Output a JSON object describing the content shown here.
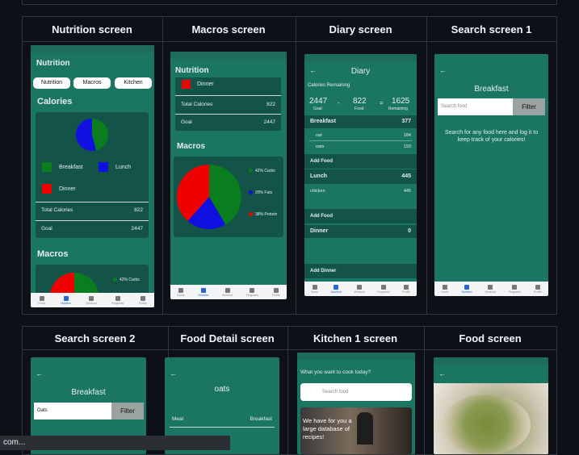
{
  "headers": {
    "nutrition": "Nutrition screen",
    "macros": "Macros screen",
    "diary": "Diary screen",
    "search1": "Search screen 1",
    "search2": "Search screen 2",
    "food_detail": "Food Detail screen",
    "kitchen1": "Kitchen 1 screen",
    "food": "Food screen"
  },
  "nav": [
    "Home",
    "Nutrition",
    "Workout",
    "Programs",
    "Profile"
  ],
  "nutrition": {
    "title": "Nutrition",
    "tabs": [
      "Nutrition",
      "Macros",
      "Kitchen"
    ],
    "calories_title": "Calories",
    "legend": [
      "Breakfast",
      "Lunch",
      "Dinner"
    ],
    "rows": [
      {
        "label": "Total Calories",
        "value": "822"
      },
      {
        "label": "Goal",
        "value": "2447"
      }
    ],
    "macros_title": "Macros",
    "carbs_label": "42% Carbs"
  },
  "macros": {
    "title": "Nutrition",
    "dinner": "Dinner",
    "rows": [
      {
        "label": "Total Calories",
        "value": "822"
      },
      {
        "label": "Goal",
        "value": "2447"
      }
    ],
    "macros_title": "Macros",
    "legend": [
      "42% Carbs",
      "20% Fats",
      "38% Protein"
    ]
  },
  "diary": {
    "title": "Diary",
    "remaining_title": "Calories Remaining",
    "goal": "2447",
    "goal_label": "Goal",
    "minus": "-",
    "food": "822",
    "food_label": "Food",
    "equals": "=",
    "remaining": "1625",
    "remaining_label": "Remaining",
    "breakfast": "Breakfast",
    "breakfast_cal": "377",
    "items_breakfast": [
      {
        "name": "oat",
        "cal": "184"
      },
      {
        "name": "oats",
        "cal": "193"
      }
    ],
    "add_food": "Add Food",
    "lunch": "Lunch",
    "lunch_cal": "445",
    "items_lunch": [
      {
        "name": "chicken",
        "cal": "445"
      }
    ],
    "dinner": "Dinner",
    "dinner_cal": "0",
    "add_dinner": "Add Dinner"
  },
  "search1": {
    "title": "Breakfast",
    "placeholder": "Search food",
    "filter": "Filter",
    "hint": "Search for any food here and log it to keep track of your calories!"
  },
  "search2": {
    "title": "Breakfast",
    "value": "Oats",
    "filter": "Filter"
  },
  "food_detail": {
    "title": "oats",
    "meal_label": "Meal",
    "meal_value": "Breakfast"
  },
  "kitchen1": {
    "question": "What you want to cook today?",
    "placeholder": "Search food",
    "banner": "We have for you a large database of recipes!"
  },
  "statusbar": {
    "text": "com..."
  },
  "colors": {
    "phone_bg": "#1b7563",
    "card": "#145448",
    "page_bg": "#0d1117"
  },
  "chart_data": [
    {
      "type": "pie",
      "title": "Calories",
      "categories": [
        "Breakfast",
        "Lunch",
        "Dinner"
      ],
      "colors": [
        "#0a7d1e",
        "#1010e0",
        "#f00000"
      ],
      "values": [
        0.54,
        0.46,
        0
      ]
    },
    {
      "type": "pie",
      "title": "Macros",
      "categories": [
        "42% Carbs",
        "20% Fats",
        "38% Protein"
      ],
      "colors": [
        "#0a7d1e",
        "#1010e0",
        "#f00000"
      ],
      "values": [
        42,
        20,
        38
      ]
    }
  ]
}
